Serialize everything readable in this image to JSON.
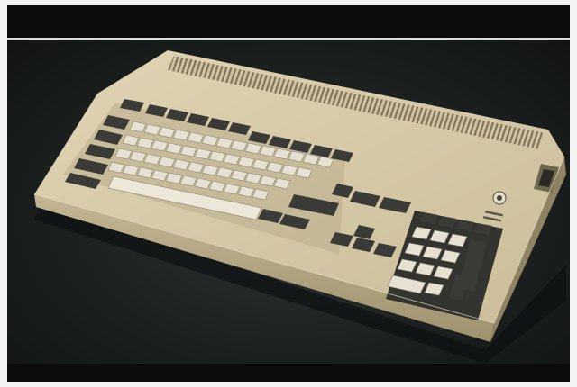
{
  "image": {
    "subject": "beige-computer-keyboard",
    "colors": {
      "case": "#d9ccab",
      "case_shadow": "#b7a987",
      "key_light": "#e9e4d6",
      "key_dark": "#3a3b36",
      "background": "#1c2120",
      "frame": "#0c0c0c"
    }
  }
}
